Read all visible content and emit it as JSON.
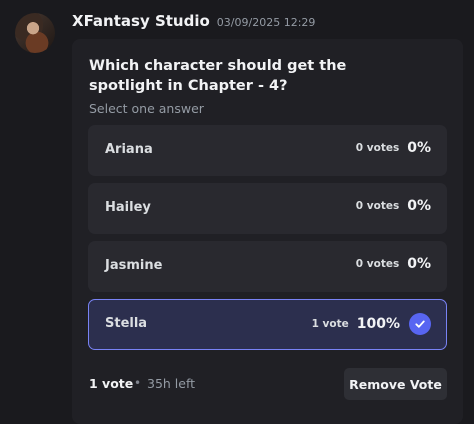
{
  "message": {
    "author": "XFantasy Studio",
    "timestamp": "03/09/2025 12:29"
  },
  "poll": {
    "question": "Which character should get the spotlight in Chapter - 4?",
    "instructions": "Select one answer",
    "options": [
      {
        "label": "Ariana",
        "votes": "0 votes",
        "percent": "0%",
        "selected": false
      },
      {
        "label": "Hailey",
        "votes": "0 votes",
        "percent": "0%",
        "selected": false
      },
      {
        "label": "Jasmine",
        "votes": "0 votes",
        "percent": "0%",
        "selected": false
      },
      {
        "label": "Stella",
        "votes": "1 vote",
        "percent": "100%",
        "selected": true
      }
    ],
    "total_votes": "1 vote",
    "separator": "•",
    "time_left": "35h left",
    "remove_vote_label": "Remove Vote"
  },
  "icons": {
    "selected_indicator": "check-icon",
    "avatar": "avatar"
  },
  "colors": {
    "accent": "#5865f2",
    "selected_border": "#7983f5",
    "selected_background": "#2c2f4e",
    "background": "#1a1a1e",
    "card": "#202025"
  }
}
